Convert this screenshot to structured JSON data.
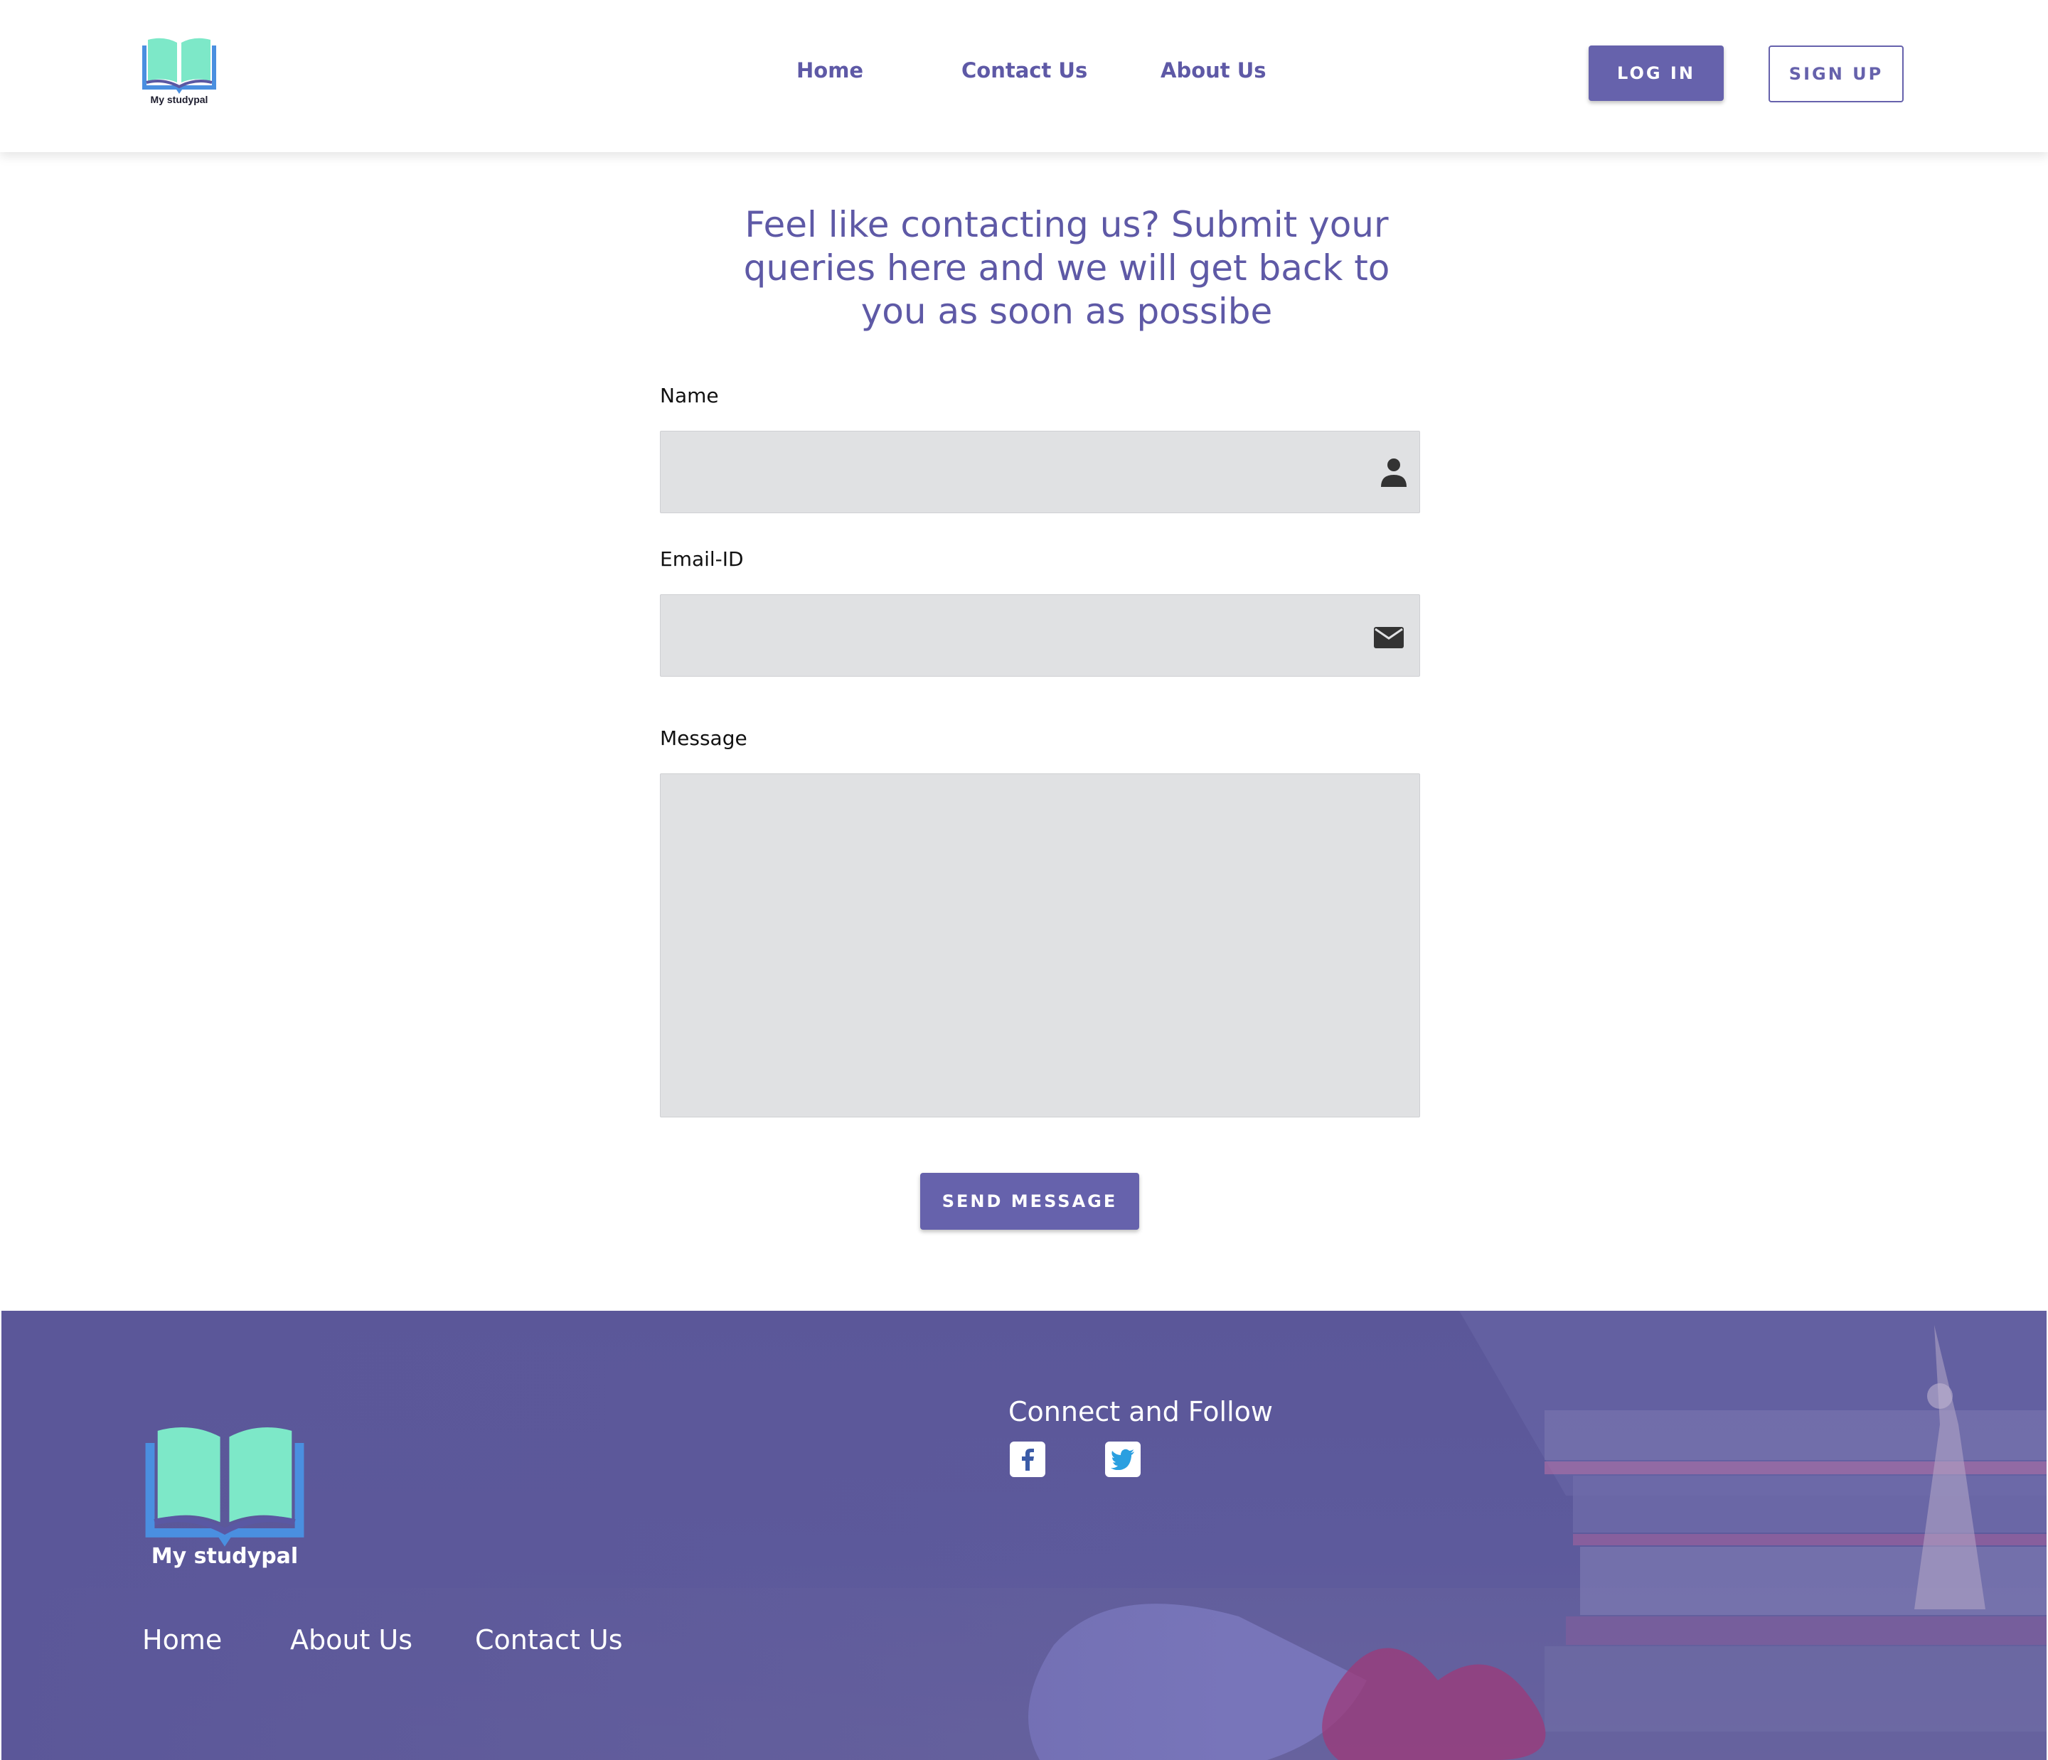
{
  "brand": {
    "name": "My studypal"
  },
  "colors": {
    "accent": "#6662ac",
    "heading": "#5e59a6",
    "input_bg": "#e0e1e3",
    "footer_bg": "#5b5799",
    "logo_book_pages": "#7de8c8",
    "logo_book_cover": "#4a8fe0"
  },
  "header": {
    "nav": [
      "Home",
      "Contact Us",
      "About Us"
    ],
    "login_label": "LOG IN",
    "signup_label": "SIGN UP"
  },
  "main": {
    "heading": "Feel like contacting us? Submit your queries here and we will get back to you as soon as possibe",
    "fields": {
      "name": {
        "label": "Name",
        "value": "",
        "icon": "user-icon"
      },
      "email": {
        "label": "Email-ID",
        "value": "",
        "icon": "envelope-icon"
      },
      "message": {
        "label": "Message",
        "value": ""
      }
    },
    "send_label": "SEND MESSAGE"
  },
  "footer": {
    "connect_title": "Connect and Follow",
    "social": [
      "facebook-icon",
      "twitter-icon"
    ],
    "links": [
      "Home",
      "About Us",
      "Contact Us"
    ]
  }
}
